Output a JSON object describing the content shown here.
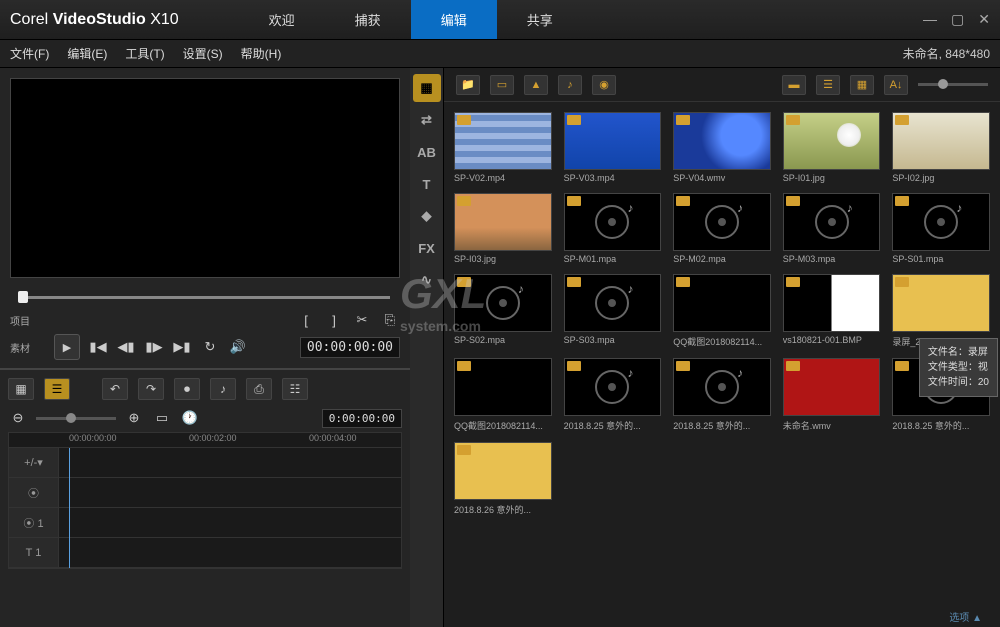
{
  "app": {
    "brand": "Corel",
    "name": "VideoStudio",
    "version": "X10"
  },
  "tabs": {
    "welcome": "欢迎",
    "capture": "捕获",
    "edit": "编辑",
    "share": "共享"
  },
  "menu": {
    "file": "文件(F)",
    "edit": "编辑(E)",
    "tools": "工具(T)",
    "settings": "设置(S)",
    "help": "帮助(H)"
  },
  "project": {
    "name": "未命名",
    "dims": "848*480"
  },
  "preview": {
    "tab1": "项目",
    "tab2": "素材",
    "timecode": "00:00:00:00"
  },
  "timeline": {
    "zoom_tc": "0:00:00:00",
    "ticks": [
      "00:00:00:00",
      "00:00:02:00",
      "00:00:04:00"
    ]
  },
  "side_tabs": {
    "media": "▦",
    "transition": "⇄",
    "title_ab": "AB",
    "title_t": "T",
    "graphic": "◆",
    "filter": "FX",
    "path": "∿"
  },
  "library": [
    {
      "name": "SP-V02.mp4",
      "kind": "mosaic"
    },
    {
      "name": "SP-V03.mp4",
      "kind": "bluegrad"
    },
    {
      "name": "SP-V04.wmv",
      "kind": "bluecirc"
    },
    {
      "name": "SP-I01.jpg",
      "kind": "dandelion"
    },
    {
      "name": "SP-I02.jpg",
      "kind": "trees"
    },
    {
      "name": "SP-I03.jpg",
      "kind": "desert"
    },
    {
      "name": "SP-M01.mpa",
      "kind": "audio"
    },
    {
      "name": "SP-M02.mpa",
      "kind": "audio"
    },
    {
      "name": "SP-M03.mpa",
      "kind": "audio"
    },
    {
      "name": "SP-S01.mpa",
      "kind": "audio"
    },
    {
      "name": "SP-S02.mpa",
      "kind": "audio"
    },
    {
      "name": "SP-S03.mpa",
      "kind": "audio"
    },
    {
      "name": "QQ截图2018082114...",
      "kind": "black"
    },
    {
      "name": "vs180821-001.BMP",
      "kind": "blackwhite"
    },
    {
      "name": "录屏_2018...",
      "kind": "yellow"
    },
    {
      "name": "QQ截图2018082114...",
      "kind": "black"
    },
    {
      "name": "2018.8.25 意外的...",
      "kind": "audio"
    },
    {
      "name": "2018.8.25 意外的...",
      "kind": "audio"
    },
    {
      "name": "未命名.wmv",
      "kind": "red"
    },
    {
      "name": "2018.8.25 意外的...",
      "kind": "audio"
    },
    {
      "name": "2018.8.26 意外的...",
      "kind": "yellow"
    }
  ],
  "tooltip": {
    "l1": "文件名：录屏",
    "l2": "文件类型：视",
    "l3": "文件时间：20"
  },
  "footer": "选项 ▲",
  "watermark": {
    "big": "GXL",
    "small": "system.com"
  }
}
